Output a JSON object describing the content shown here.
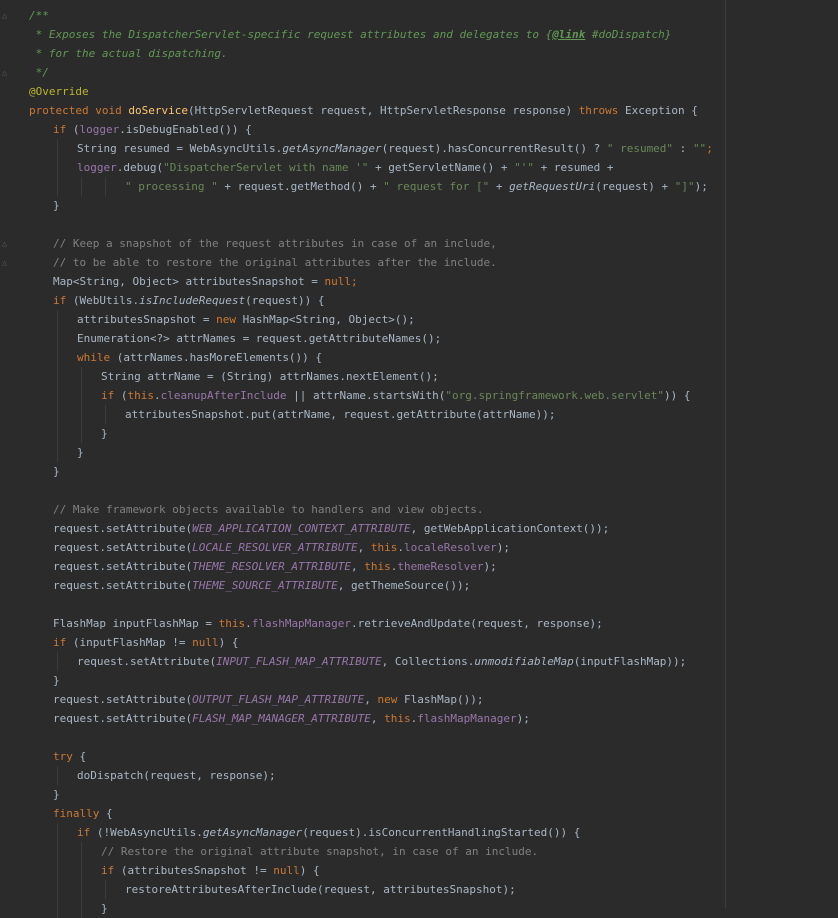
{
  "editor": {
    "colors": {
      "background": "#2b2b2b",
      "plain": "#a9b7c6",
      "keyword": "#cc7832",
      "string": "#6a8759",
      "comment": "#808080",
      "doc": "#629755",
      "annotation": "#bbb529",
      "method_decl": "#ffc66d",
      "field": "#9876aa"
    },
    "fold_markers": [
      "fold-icon",
      "fold-icon",
      "fold-icon",
      "fold-icon"
    ],
    "lines": [
      {
        "indent": 0,
        "tokens": [
          {
            "t": "/**",
            "c": "doc"
          }
        ]
      },
      {
        "indent": 0,
        "tokens": [
          {
            "t": " * Exposes the DispatcherServlet-specific request attributes and delegates to {",
            "c": "doc"
          },
          {
            "t": "@link",
            "c": "link"
          },
          {
            "t": " #doDispatch}",
            "c": "doc"
          }
        ]
      },
      {
        "indent": 0,
        "tokens": [
          {
            "t": " * for the actual dispatching.",
            "c": "doc"
          }
        ]
      },
      {
        "indent": 0,
        "tokens": [
          {
            "t": " */",
            "c": "doc"
          }
        ]
      },
      {
        "indent": 0,
        "tokens": [
          {
            "t": "@Override",
            "c": "ann"
          }
        ]
      },
      {
        "indent": 0,
        "tokens": [
          {
            "t": "protected void ",
            "c": "kw"
          },
          {
            "t": "doService",
            "c": "fn"
          },
          {
            "t": "(HttpServletRequest request, HttpServletResponse response) ",
            "c": "pl"
          },
          {
            "t": "throws ",
            "c": "kw"
          },
          {
            "t": "Exception {",
            "c": "pl"
          }
        ]
      },
      {
        "indent": 1,
        "tokens": [
          {
            "t": "if ",
            "c": "kw"
          },
          {
            "t": "(",
            "c": "pl"
          },
          {
            "t": "logger",
            "c": "fld"
          },
          {
            "t": ".isDebugEnabled()) {",
            "c": "pl"
          }
        ]
      },
      {
        "indent": 2,
        "tokens": [
          {
            "t": "String resumed = WebAsyncUtils.",
            "c": "pl"
          },
          {
            "t": "getAsyncManager",
            "c": "st"
          },
          {
            "t": "(request).hasConcurrentResult() ? ",
            "c": "pl"
          },
          {
            "t": "\" resumed\"",
            "c": "str"
          },
          {
            "t": " : ",
            "c": "pl"
          },
          {
            "t": "\"\"",
            "c": "str"
          },
          {
            "t": ";",
            "c": "kw"
          }
        ]
      },
      {
        "indent": 2,
        "tokens": [
          {
            "t": "logger",
            "c": "fld"
          },
          {
            "t": ".debug(",
            "c": "pl"
          },
          {
            "t": "\"DispatcherServlet with name '\"",
            "c": "str"
          },
          {
            "t": " + getServletName() + ",
            "c": "pl"
          },
          {
            "t": "\"'\"",
            "c": "str"
          },
          {
            "t": " + resumed +",
            "c": "pl"
          }
        ]
      },
      {
        "indent": 4,
        "tokens": [
          {
            "t": "\" processing \"",
            "c": "str"
          },
          {
            "t": " + request.getMethod() + ",
            "c": "pl"
          },
          {
            "t": "\" request for [\"",
            "c": "str"
          },
          {
            "t": " + ",
            "c": "pl"
          },
          {
            "t": "getRequestUri",
            "c": "st"
          },
          {
            "t": "(request) + ",
            "c": "pl"
          },
          {
            "t": "\"]\"",
            "c": "str"
          },
          {
            "t": ");",
            "c": "pl"
          }
        ]
      },
      {
        "indent": 1,
        "tokens": [
          {
            "t": "}",
            "c": "pl"
          }
        ]
      },
      {
        "indent": 0,
        "tokens": []
      },
      {
        "indent": 1,
        "tokens": [
          {
            "t": "// Keep a snapshot of the request attributes in case of an include,",
            "c": "cm"
          }
        ]
      },
      {
        "indent": 1,
        "tokens": [
          {
            "t": "// to be able to restore the original attributes after the include.",
            "c": "cm"
          }
        ]
      },
      {
        "indent": 1,
        "tokens": [
          {
            "t": "Map<String, Object> attributesSnapshot = ",
            "c": "pl"
          },
          {
            "t": "null;",
            "c": "kw"
          }
        ]
      },
      {
        "indent": 1,
        "tokens": [
          {
            "t": "if ",
            "c": "kw"
          },
          {
            "t": "(WebUtils.",
            "c": "pl"
          },
          {
            "t": "isIncludeRequest",
            "c": "st"
          },
          {
            "t": "(request)) {",
            "c": "pl"
          }
        ]
      },
      {
        "indent": 2,
        "tokens": [
          {
            "t": "attributesSnapshot = ",
            "c": "pl"
          },
          {
            "t": "new ",
            "c": "kw"
          },
          {
            "t": "HashMap<String, Object>();",
            "c": "pl"
          }
        ]
      },
      {
        "indent": 2,
        "tokens": [
          {
            "t": "Enumeration<?> attrNames = request.getAttributeNames();",
            "c": "pl"
          }
        ]
      },
      {
        "indent": 2,
        "tokens": [
          {
            "t": "while ",
            "c": "kw"
          },
          {
            "t": "(attrNames.hasMoreElements()) {",
            "c": "pl"
          }
        ]
      },
      {
        "indent": 3,
        "tokens": [
          {
            "t": "String attrName = (String) attrNames.nextElement();",
            "c": "pl"
          }
        ]
      },
      {
        "indent": 3,
        "tokens": [
          {
            "t": "if ",
            "c": "kw"
          },
          {
            "t": "(",
            "c": "pl"
          },
          {
            "t": "this",
            "c": "kw"
          },
          {
            "t": ".",
            "c": "pl"
          },
          {
            "t": "cleanupAfterInclude",
            "c": "fld"
          },
          {
            "t": " || attrName.startsWith(",
            "c": "pl"
          },
          {
            "t": "\"org.springframework.web.servlet\"",
            "c": "str"
          },
          {
            "t": ")) {",
            "c": "pl"
          }
        ]
      },
      {
        "indent": 4,
        "tokens": [
          {
            "t": "attributesSnapshot.put(attrName, request.getAttribute(attrName));",
            "c": "pl"
          }
        ]
      },
      {
        "indent": 3,
        "tokens": [
          {
            "t": "}",
            "c": "pl"
          }
        ]
      },
      {
        "indent": 2,
        "tokens": [
          {
            "t": "}",
            "c": "pl"
          }
        ]
      },
      {
        "indent": 1,
        "tokens": [
          {
            "t": "}",
            "c": "pl"
          }
        ]
      },
      {
        "indent": 0,
        "tokens": []
      },
      {
        "indent": 1,
        "tokens": [
          {
            "t": "// Make framework objects available to handlers and view objects.",
            "c": "cm"
          }
        ]
      },
      {
        "indent": 1,
        "tokens": [
          {
            "t": "request.setAttribute(",
            "c": "pl"
          },
          {
            "t": "WEB_APPLICATION_CONTEXT_ATTRIBUTE",
            "c": "const"
          },
          {
            "t": ", getWebApplicationContext());",
            "c": "pl"
          }
        ]
      },
      {
        "indent": 1,
        "tokens": [
          {
            "t": "request.setAttribute(",
            "c": "pl"
          },
          {
            "t": "LOCALE_RESOLVER_ATTRIBUTE",
            "c": "const"
          },
          {
            "t": ", ",
            "c": "pl"
          },
          {
            "t": "this",
            "c": "kw"
          },
          {
            "t": ".",
            "c": "pl"
          },
          {
            "t": "localeResolver",
            "c": "fld"
          },
          {
            "t": ");",
            "c": "pl"
          }
        ]
      },
      {
        "indent": 1,
        "tokens": [
          {
            "t": "request.setAttribute(",
            "c": "pl"
          },
          {
            "t": "THEME_RESOLVER_ATTRIBUTE",
            "c": "const"
          },
          {
            "t": ", ",
            "c": "pl"
          },
          {
            "t": "this",
            "c": "kw"
          },
          {
            "t": ".",
            "c": "pl"
          },
          {
            "t": "themeResolver",
            "c": "fld"
          },
          {
            "t": ");",
            "c": "pl"
          }
        ]
      },
      {
        "indent": 1,
        "tokens": [
          {
            "t": "request.setAttribute(",
            "c": "pl"
          },
          {
            "t": "THEME_SOURCE_ATTRIBUTE",
            "c": "const"
          },
          {
            "t": ", getThemeSource());",
            "c": "pl"
          }
        ]
      },
      {
        "indent": 0,
        "tokens": []
      },
      {
        "indent": 1,
        "tokens": [
          {
            "t": "FlashMap inputFlashMap = ",
            "c": "pl"
          },
          {
            "t": "this",
            "c": "kw"
          },
          {
            "t": ".",
            "c": "pl"
          },
          {
            "t": "flashMapManager",
            "c": "fld"
          },
          {
            "t": ".retrieveAndUpdate(request, response);",
            "c": "pl"
          }
        ]
      },
      {
        "indent": 1,
        "tokens": [
          {
            "t": "if ",
            "c": "kw"
          },
          {
            "t": "(inputFlashMap != ",
            "c": "pl"
          },
          {
            "t": "null",
            "c": "kw"
          },
          {
            "t": ") {",
            "c": "pl"
          }
        ]
      },
      {
        "indent": 2,
        "tokens": [
          {
            "t": "request.setAttribute(",
            "c": "pl"
          },
          {
            "t": "INPUT_FLASH_MAP_ATTRIBUTE",
            "c": "const"
          },
          {
            "t": ", Collections.",
            "c": "pl"
          },
          {
            "t": "unmodifiableMap",
            "c": "st"
          },
          {
            "t": "(inputFlashMap));",
            "c": "pl"
          }
        ]
      },
      {
        "indent": 1,
        "tokens": [
          {
            "t": "}",
            "c": "pl"
          }
        ]
      },
      {
        "indent": 1,
        "tokens": [
          {
            "t": "request.setAttribute(",
            "c": "pl"
          },
          {
            "t": "OUTPUT_FLASH_MAP_ATTRIBUTE",
            "c": "const"
          },
          {
            "t": ", ",
            "c": "pl"
          },
          {
            "t": "new ",
            "c": "kw"
          },
          {
            "t": "FlashMap());",
            "c": "pl"
          }
        ]
      },
      {
        "indent": 1,
        "tokens": [
          {
            "t": "request.setAttribute(",
            "c": "pl"
          },
          {
            "t": "FLASH_MAP_MANAGER_ATTRIBUTE",
            "c": "const"
          },
          {
            "t": ", ",
            "c": "pl"
          },
          {
            "t": "this",
            "c": "kw"
          },
          {
            "t": ".",
            "c": "pl"
          },
          {
            "t": "flashMapManager",
            "c": "fld"
          },
          {
            "t": ");",
            "c": "pl"
          }
        ]
      },
      {
        "indent": 0,
        "tokens": []
      },
      {
        "indent": 1,
        "tokens": [
          {
            "t": "try ",
            "c": "kw"
          },
          {
            "t": "{",
            "c": "pl"
          }
        ]
      },
      {
        "indent": 2,
        "tokens": [
          {
            "t": "doDispatch(request, response);",
            "c": "pl"
          }
        ]
      },
      {
        "indent": 1,
        "tokens": [
          {
            "t": "}",
            "c": "pl"
          }
        ]
      },
      {
        "indent": 1,
        "tokens": [
          {
            "t": "finally ",
            "c": "kw"
          },
          {
            "t": "{",
            "c": "pl"
          }
        ]
      },
      {
        "indent": 2,
        "tokens": [
          {
            "t": "if ",
            "c": "kw"
          },
          {
            "t": "(!WebAsyncUtils.",
            "c": "pl"
          },
          {
            "t": "getAsyncManager",
            "c": "st"
          },
          {
            "t": "(request).isConcurrentHandlingStarted()) {",
            "c": "pl"
          }
        ]
      },
      {
        "indent": 3,
        "tokens": [
          {
            "t": "// Restore the original attribute snapshot, in case of an include.",
            "c": "cm"
          }
        ]
      },
      {
        "indent": 3,
        "tokens": [
          {
            "t": "if ",
            "c": "kw"
          },
          {
            "t": "(attributesSnapshot != ",
            "c": "pl"
          },
          {
            "t": "null",
            "c": "kw"
          },
          {
            "t": ") {",
            "c": "pl"
          }
        ]
      },
      {
        "indent": 4,
        "tokens": [
          {
            "t": "restoreAttributesAfterInclude(request, attributesSnapshot);",
            "c": "pl"
          }
        ]
      },
      {
        "indent": 3,
        "tokens": [
          {
            "t": "}",
            "c": "pl"
          }
        ]
      }
    ]
  }
}
